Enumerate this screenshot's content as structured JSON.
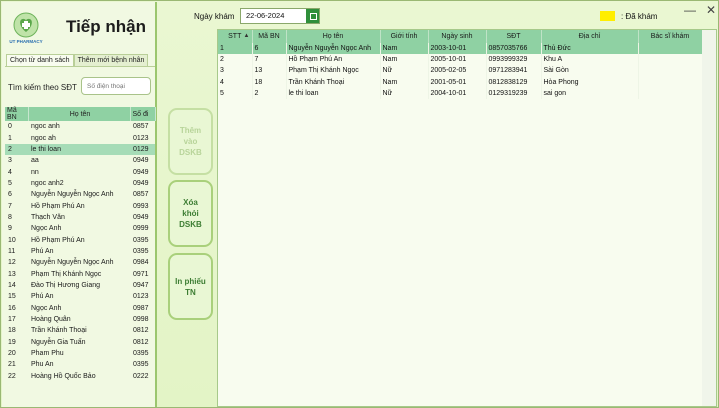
{
  "window": {
    "minimize_label": "—",
    "close_label": "✕"
  },
  "app": {
    "title": "Tiếp nhận",
    "logo_text": "UT PHARMACY"
  },
  "tabs": [
    "Chọn từ danh sách",
    "Thêm mới bệnh nhân"
  ],
  "search": {
    "label": "Tìm kiếm theo SĐT",
    "placeholder": "Số điện thoại"
  },
  "patient_table": {
    "headers": [
      "Mã BN",
      "Họ tên",
      "Số đi"
    ],
    "rows": [
      [
        "0",
        "ngoc anh",
        "0857"
      ],
      [
        "1",
        "ngoc ah",
        "0123"
      ],
      [
        "2",
        "le thi loan",
        "0129"
      ],
      [
        "3",
        "aa",
        "0949"
      ],
      [
        "4",
        "nn",
        "0949"
      ],
      [
        "5",
        "ngoc anh2",
        "0949"
      ],
      [
        "6",
        "Nguyễn Nguyễn Ngọc Anh",
        "0857"
      ],
      [
        "7",
        "Hồ Phạm Phú An",
        "0993"
      ],
      [
        "8",
        "Thạch Văn",
        "0949"
      ],
      [
        "9",
        "Ngọc Anh",
        "0999"
      ],
      [
        "10",
        "Hồ Phạm Phú An",
        "0395"
      ],
      [
        "11",
        "Phú An",
        "0395"
      ],
      [
        "12",
        "Nguyễn Nguyễn Ngọc Anh",
        "0984"
      ],
      [
        "13",
        "Phạm Thị Khánh Ngọc",
        "0971"
      ],
      [
        "14",
        "Đào Thị Hương Giang",
        "0947"
      ],
      [
        "15",
        "Phú An",
        "0123"
      ],
      [
        "16",
        "Ngọc Anh",
        "0987"
      ],
      [
        "17",
        "Hoàng Quân",
        "0998"
      ],
      [
        "18",
        "Trần Khánh Thoại",
        "0812"
      ],
      [
        "19",
        "Nguyễn Gia Tuấn",
        "0812"
      ],
      [
        "20",
        "Pham Phu",
        "0395"
      ],
      [
        "21",
        "Phu An",
        "0395"
      ],
      [
        "22",
        "Hoàng Hồ Quốc Bảo",
        "0222"
      ]
    ],
    "selected_index": 2
  },
  "actions": {
    "add_label": "Thêm\nvào\nDSKB",
    "remove_label": "Xóa\nkhỏi\nDSKB",
    "print_label": "In phiếu\nTN"
  },
  "exam_date": {
    "label": "Ngày khám",
    "value": "22-06-2024"
  },
  "legend": {
    "label": ": Đã khám",
    "color": "#ffee00"
  },
  "exam_table": {
    "headers": [
      "STT",
      "Mã BN",
      "Họ tên",
      "Giới tính",
      "Ngày sinh",
      "SĐT",
      "Địa chỉ",
      "Bác sĩ khám"
    ],
    "rows": [
      [
        "1",
        "6",
        "Nguyễn Nguyễn Ngọc Anh",
        "Nam",
        "2003-10-01",
        "0857035766",
        "Thủ Đức",
        ""
      ],
      [
        "2",
        "7",
        "Hồ Phạm Phú An",
        "Nam",
        "2005-10-01",
        "0993999329",
        "Khu A",
        ""
      ],
      [
        "3",
        "13",
        "Phạm Thị Khánh Ngọc",
        "Nữ",
        "2005-02-05",
        "0971283941",
        "Sài Gòn",
        ""
      ],
      [
        "4",
        "18",
        "Trần Khánh Thoại",
        "Nam",
        "2001-05-01",
        "0812838129",
        "Hòa Phong",
        ""
      ],
      [
        "5",
        "2",
        "le thi loan",
        "Nữ",
        "2004-10-01",
        "0129319239",
        "sai gon",
        ""
      ]
    ],
    "selected_index": 0
  },
  "colors": {
    "accent": "#8fd1a3",
    "background": "#e7f5cc",
    "button_text": "#3d7d33"
  }
}
